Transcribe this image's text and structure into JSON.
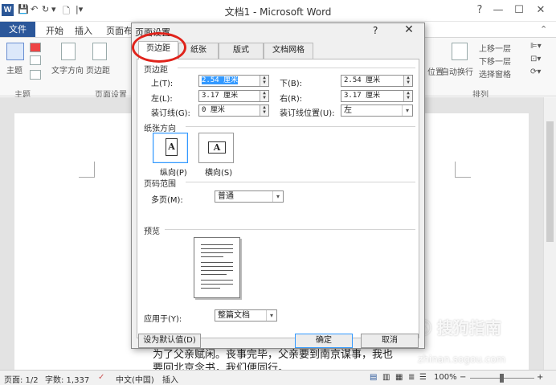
{
  "app": {
    "logo": "W",
    "title": "文档1 - Microsoft Word",
    "qat": [
      "💾",
      "↶",
      "↻",
      "▾",
      "🗋",
      "|▾"
    ],
    "window_controls": [
      "?",
      "—",
      "☐",
      "✕"
    ]
  },
  "ribbon": {
    "tabs": [
      "文件",
      "开始",
      "插入",
      "页面布"
    ],
    "buttons": {
      "theme": "主题",
      "text_direction": "文字方向",
      "margins": "页边距",
      "bring_forward": "上移一层",
      "send_backward": "下移一层",
      "selection_pane": "选择窗格",
      "position": "位置",
      "wrap_text": "自动换行"
    },
    "group_labels": [
      "主题",
      "页面设置",
      "排列"
    ]
  },
  "document": {
    "text_lines": [
      "为了父亲赋闲。丧事完毕，父亲要到南京谋事，我也",
      "要回北京念书，我们便同行。"
    ]
  },
  "dialog": {
    "title": "页面设置",
    "help": "?",
    "close": "✕",
    "tabs": [
      "页边距",
      "纸张",
      "版式",
      "文档网格"
    ],
    "active_tab": "页边距",
    "margins": {
      "section": "页边距",
      "top_label": "上(T):",
      "top_value": "2.54 厘米",
      "bottom_label": "下(B):",
      "bottom_value": "2.54 厘米",
      "left_label": "左(L):",
      "left_value": "3.17 厘米",
      "right_label": "右(R):",
      "right_value": "3.17 厘米",
      "gutter_label": "装订线(G):",
      "gutter_value": "0 厘米",
      "gutter_position_label": "装订线位置(U):",
      "gutter_position_value": "左"
    },
    "orientation": {
      "section": "纸张方向",
      "portrait": "纵向(P)",
      "landscape": "横向(S)",
      "selected": "portrait"
    },
    "pages": {
      "section": "页码范围",
      "multiple_label": "多页(M):",
      "multiple_value": "普通"
    },
    "preview": {
      "section": "预览",
      "apply_label": "应用于(Y):",
      "apply_value": "整篇文档"
    },
    "buttons": {
      "default": "设为默认值(D)",
      "ok": "确定",
      "cancel": "取消"
    }
  },
  "status": {
    "page": "页面: 1/2",
    "words": "字数: 1,337",
    "language": "中文(中国)",
    "mode": "插入",
    "zoom": "100%",
    "zoom_minus": "−",
    "zoom_plus": "+"
  },
  "watermark": {
    "brand": "搜狗指南",
    "url": "zhinan.sogou.com"
  },
  "colors": {
    "word_blue": "#2b579a",
    "highlight": "#3399ff",
    "annotation_red": "#e0231b"
  }
}
